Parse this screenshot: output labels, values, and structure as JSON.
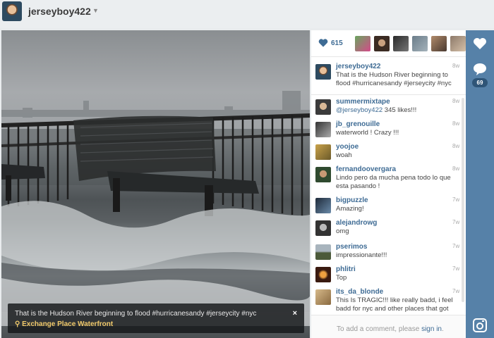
{
  "header": {
    "username": "jerseyboy422"
  },
  "post": {
    "caption": "That is the Hudson River beginning to flood #hurricanesandy #jerseycity #nyc",
    "location": "Exchange Place Waterfront",
    "close_label": "×"
  },
  "likes": {
    "count": "615"
  },
  "comments_count": "69",
  "author_comment": {
    "user": "jerseyboy422",
    "time": "8w",
    "text": "That is the Hudson River beginning to flood #hurricanesandy #jerseycity #nyc"
  },
  "comments": [
    {
      "user": "summermixtape",
      "time": "8w",
      "mention": "@jerseyboy422",
      "text": " 345 likes!!!"
    },
    {
      "user": "jb_grenouille",
      "time": "8w",
      "text": "waterworld ! Crazy !!!"
    },
    {
      "user": "yoojoe",
      "time": "8w",
      "text": "woah"
    },
    {
      "user": "fernandoovergara",
      "time": "8w",
      "text": "Lindo pero da mucha pena todo lo que esta pasando !"
    },
    {
      "user": "bigpuzzle",
      "time": "7w",
      "text": "Amazing!"
    },
    {
      "user": "alejandrowg",
      "time": "7w",
      "text": "omg"
    },
    {
      "user": "pserimos",
      "time": "7w",
      "text": "impressionante!!!"
    },
    {
      "user": "phlitri",
      "time": "7w",
      "text": "Top"
    },
    {
      "user": "its_da_blonde",
      "time": "7w",
      "text": "This Is TRAGIC!!! like really badd, i feel badd for nyc and other places that got"
    }
  ],
  "add_comment": {
    "prompt": "To add a comment, please ",
    "signin": "sign in",
    "end": "."
  },
  "colors": {
    "accent": "#3e6b94",
    "action_bar": "#5681a8",
    "location": "#f0c96a"
  },
  "icons": {
    "like": "heart-icon",
    "comment": "speech-bubble-icon",
    "brand": "camera-icon"
  }
}
